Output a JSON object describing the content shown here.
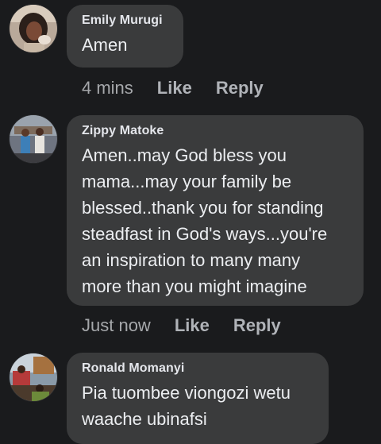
{
  "comments": [
    {
      "author": "Emily Murugi",
      "text": "Amen",
      "time": "4 mins",
      "like_label": "Like",
      "reply_label": "Reply"
    },
    {
      "author": "Zippy Matoke",
      "text": "Amen..may God bless you\nmama...may your family be\nblessed..thank you for standing\nsteadfast in God's ways...you're\nan inspiration to many many\nmore than you might imagine",
      "time": "Just now",
      "like_label": "Like",
      "reply_label": "Reply"
    },
    {
      "author": "Ronald Momanyi",
      "text": "Pia tuombee viongozi wetu\nwaache ubinafsi"
    }
  ],
  "colors": {
    "background": "#1a1b1d",
    "bubble": "#3a3b3c",
    "text": "#e4e6eb",
    "meta": "#b0b3b8"
  }
}
